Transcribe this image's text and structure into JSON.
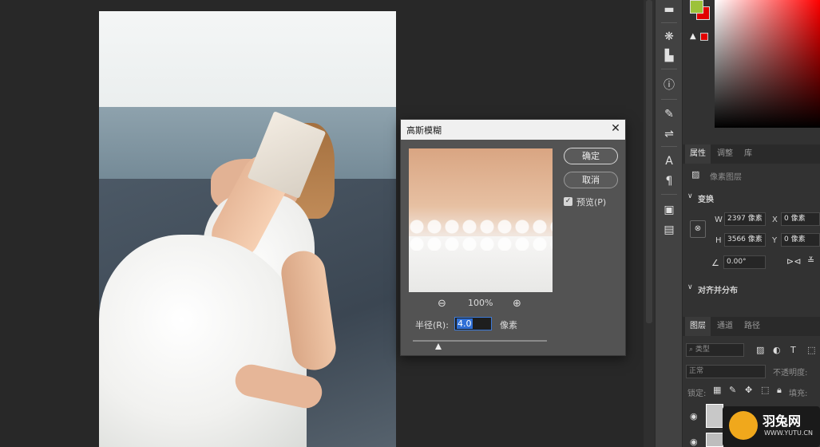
{
  "dialog": {
    "title": "高斯模糊",
    "ok_label": "确定",
    "cancel_label": "取消",
    "preview_label": "预览(P)",
    "preview_checked": true,
    "zoom": "100%",
    "radius_label": "半径(R):",
    "radius_value": "4.0",
    "unit": "像素",
    "radius_slider_fraction": 0.19
  },
  "colors": {
    "foreground": "#9cc23a",
    "background": "#e20000",
    "gamut_warning": "#e20000"
  },
  "properties": {
    "tabs": [
      "属性",
      "调整",
      "库"
    ],
    "layer_type": "像素图层",
    "section_transform": "变换",
    "w_label": "W",
    "w_value": "2397 像素",
    "x_label": "X",
    "x_value": "0 像素",
    "h_label": "H",
    "h_value": "3566 像素",
    "y_label": "Y",
    "y_value": "0 像素",
    "angle_value": "0.00°",
    "section_align": "对齐并分布"
  },
  "layers": {
    "tabs": [
      "图层",
      "通道",
      "路径"
    ],
    "filter_placeholder": "类型",
    "blend_mode": "正常",
    "opacity_label": "不透明度:",
    "lock_label": "锁定:",
    "fill_label": "填充:"
  },
  "watermark": {
    "name": "羽兔网",
    "url": "WWW.YUTU.CN"
  }
}
